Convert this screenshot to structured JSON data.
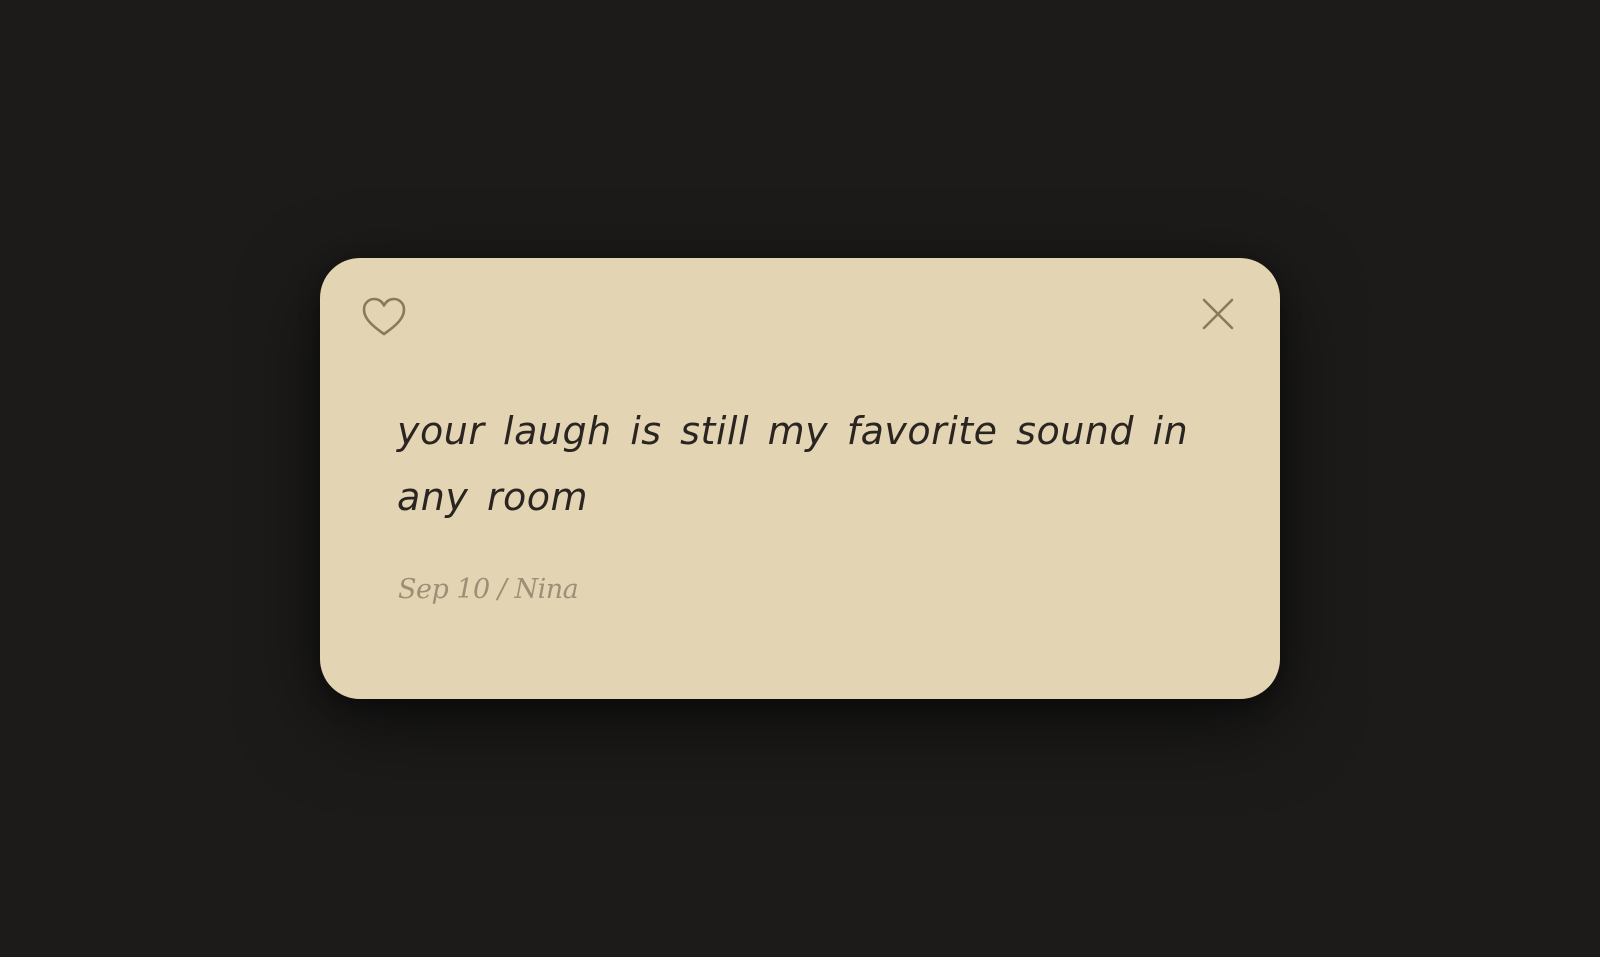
{
  "note": {
    "text": "your laugh is still my favorite sound in any room",
    "date": "Sep 10",
    "separator": "/",
    "author": "Nina"
  },
  "actions": {
    "like_icon": "heart-outline-icon",
    "close_icon": "close-icon"
  },
  "colors": {
    "background": "#1c1b1a",
    "card": "#e3d4b3",
    "text": "#2a2520",
    "meta": "#9c8f75",
    "icon": "#8a7a58"
  }
}
